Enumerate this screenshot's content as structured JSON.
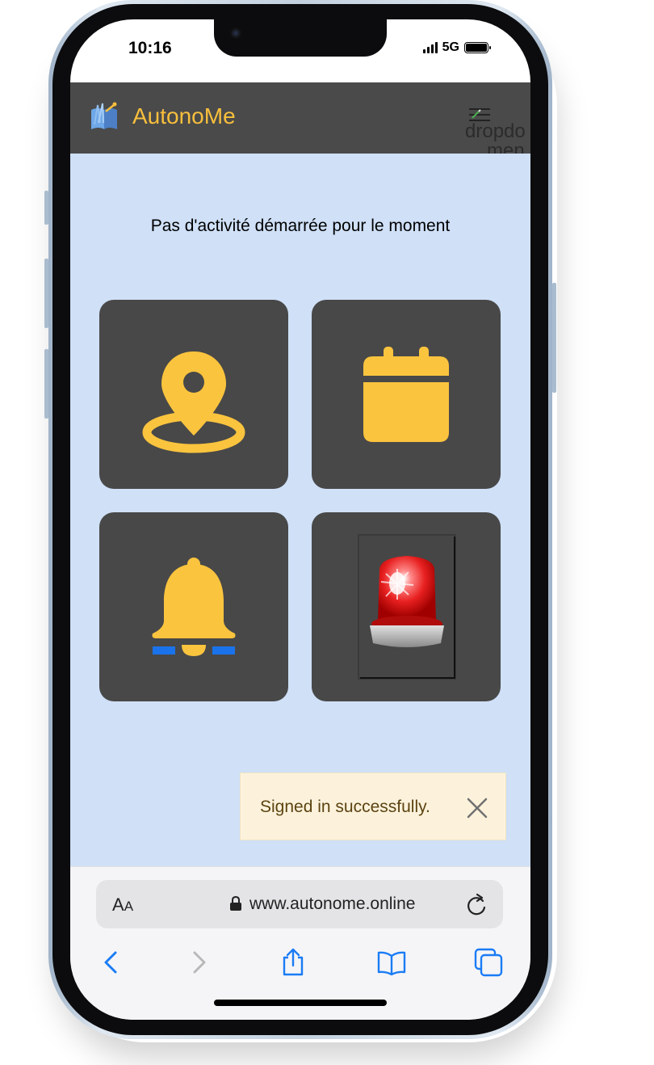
{
  "status_bar": {
    "time": "10:16",
    "network": "5G"
  },
  "navbar": {
    "brand": "AutonoMe",
    "menu_alt_line1": "dropdo",
    "menu_alt_line2": "men"
  },
  "main": {
    "status_message": "Pas d'activité démarrée pour le moment",
    "tiles": [
      {
        "icon": "map-pin-icon"
      },
      {
        "icon": "calendar-icon"
      },
      {
        "icon": "bell-icon"
      },
      {
        "icon": "emergency-siren-icon"
      }
    ]
  },
  "toast": {
    "message": "Signed in successfully."
  },
  "safari": {
    "text_size_label": "A",
    "text_size_label_small": "A",
    "url": "www.autonome.online"
  },
  "colors": {
    "navbar_bg": "#4a4a4a",
    "brand": "#f8bf3c",
    "page_bg": "#cfe0f7",
    "tile_bg": "#484848",
    "icon_accent": "#fbc43e",
    "toast_bg": "#fcf2dc",
    "safari_blue": "#1a7cf5"
  }
}
